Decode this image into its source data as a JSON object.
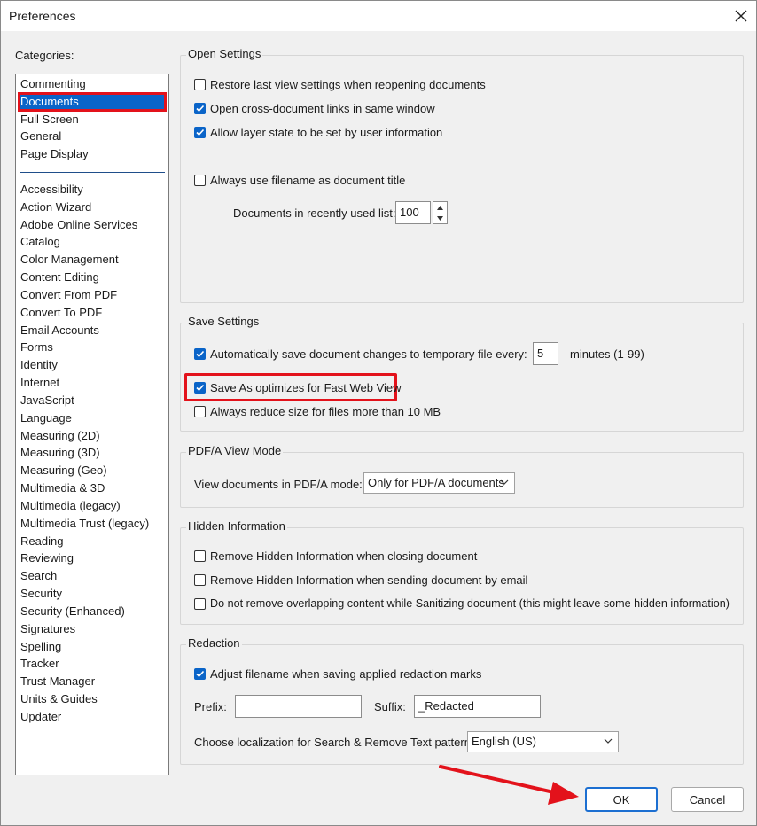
{
  "window": {
    "title": "Preferences"
  },
  "categories": {
    "label": "Categories:",
    "top_items": [
      "Commenting",
      "Documents",
      "Full Screen",
      "General",
      "Page Display"
    ],
    "selected": "Documents",
    "items": [
      "Accessibility",
      "Action Wizard",
      "Adobe Online Services",
      "Catalog",
      "Color Management",
      "Content Editing",
      "Convert From PDF",
      "Convert To PDF",
      "Email Accounts",
      "Forms",
      "Identity",
      "Internet",
      "JavaScript",
      "Language",
      "Measuring (2D)",
      "Measuring (3D)",
      "Measuring (Geo)",
      "Multimedia & 3D",
      "Multimedia (legacy)",
      "Multimedia Trust (legacy)",
      "Reading",
      "Reviewing",
      "Search",
      "Security",
      "Security (Enhanced)",
      "Signatures",
      "Spelling",
      "Tracker",
      "Trust Manager",
      "Units & Guides",
      "Updater"
    ]
  },
  "open_settings": {
    "title": "Open Settings",
    "restore_last_view": {
      "label": "Restore last view settings when reopening documents",
      "checked": false
    },
    "open_cross_doc_links": {
      "label": "Open cross-document links in same window",
      "checked": true
    },
    "allow_layer_state": {
      "label": "Allow layer state to be set by user information",
      "checked": true
    },
    "filename_as_title": {
      "label": "Always use filename as document title",
      "checked": false
    },
    "recent_list_label": "Documents in recently used list:",
    "recent_list_value": "100"
  },
  "save_settings": {
    "title": "Save Settings",
    "auto_save": {
      "label": "Automatically save document changes to temporary file every:",
      "checked": true
    },
    "auto_save_minutes": "5",
    "minutes_label": "minutes (1-99)",
    "fast_web_view": {
      "label": "Save As optimizes for Fast Web View",
      "checked": true
    },
    "reduce_size": {
      "label": "Always reduce size for files more than 10 MB",
      "checked": false
    }
  },
  "pdfa": {
    "title": "PDF/A View Mode",
    "label": "View documents in PDF/A mode:",
    "value": "Only for PDF/A documents"
  },
  "hidden_info": {
    "title": "Hidden Information",
    "remove_on_close": {
      "label": "Remove Hidden Information when closing document",
      "checked": false
    },
    "remove_on_email": {
      "label": "Remove Hidden Information when sending document by email",
      "checked": false
    },
    "no_remove_overlap": {
      "label": "Do not remove overlapping content while Sanitizing document (this might leave some hidden information)",
      "checked": false
    }
  },
  "redaction": {
    "title": "Redaction",
    "adjust_filename": {
      "label": "Adjust filename when saving applied redaction marks",
      "checked": true
    },
    "prefix_label": "Prefix:",
    "prefix_value": "",
    "suffix_label": "Suffix:",
    "suffix_value": "_Redacted",
    "localization_label": "Choose localization for Search & Remove Text patterns:",
    "localization_value": "English (US)"
  },
  "buttons": {
    "ok": "OK",
    "cancel": "Cancel"
  },
  "colors": {
    "accent": "#0a64c8",
    "annotation": "#e3121b",
    "window_bg": "#f0f0f0"
  }
}
